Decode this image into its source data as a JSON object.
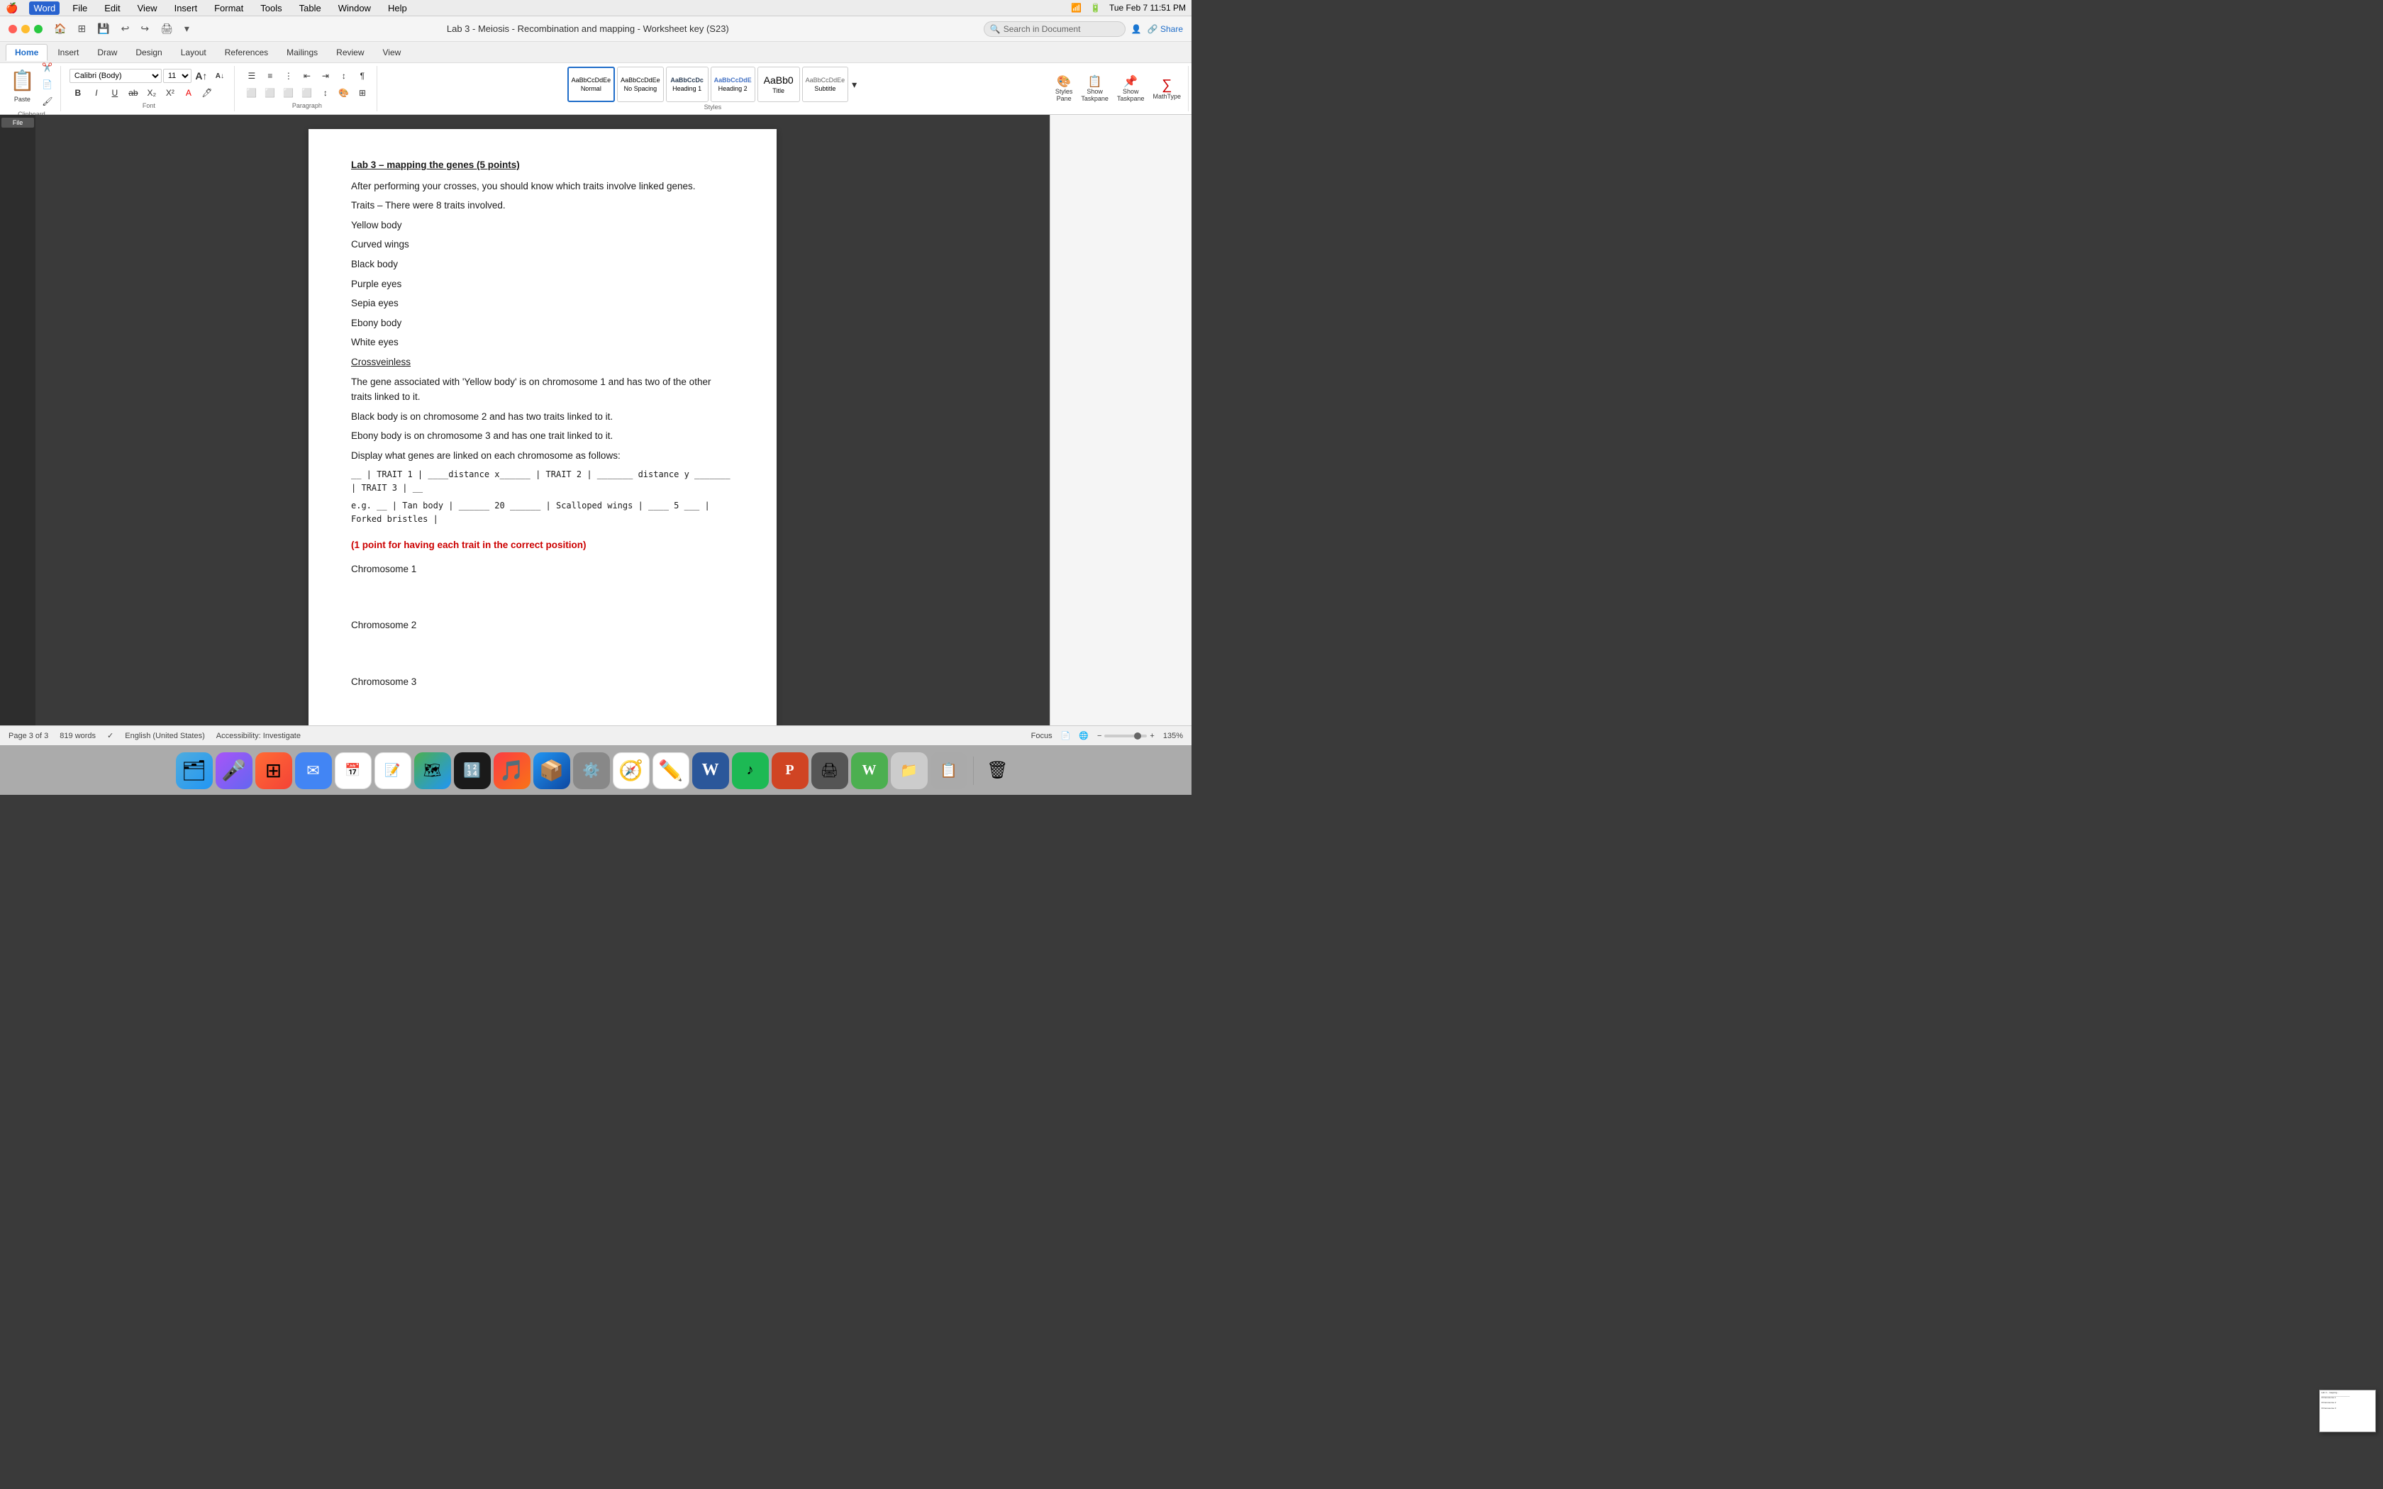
{
  "menubar": {
    "apple": "🍎",
    "app_name": "Word",
    "menus": [
      "File",
      "Edit",
      "View",
      "Insert",
      "Format",
      "Tools",
      "Table",
      "Window",
      "Help"
    ],
    "right": {
      "time": "Tue Feb 7  11:51 PM",
      "battery": "100%"
    }
  },
  "titlebar": {
    "doc_title": "Lab 3 - Meiosis - Recombination and mapping - Worksheet key (S23)",
    "search_placeholder": "Search in Document"
  },
  "ribbon": {
    "tabs": [
      "Home",
      "Insert",
      "Draw",
      "Design",
      "Layout",
      "References",
      "Mailings",
      "Review",
      "View"
    ],
    "active_tab": "Home",
    "clipboard": {
      "paste_label": "Paste",
      "cut_label": "Cut",
      "copy_label": "Copy",
      "format_painter_label": "Format Painter"
    },
    "font": {
      "name": "Calibri (Body)",
      "size": "11",
      "grow_label": "A",
      "shrink_label": "A"
    },
    "paragraph": {
      "bullets_label": "Bullets",
      "numbering_label": "Numbering"
    },
    "styles": [
      {
        "name": "Normal",
        "preview": "AaBbCcDdEe"
      },
      {
        "name": "No Spacing",
        "preview": "AaBbCcDdEe"
      },
      {
        "name": "Heading 1",
        "preview": "AaBbCcDc"
      },
      {
        "name": "Heading 2",
        "preview": "AaBbCcDdE"
      },
      {
        "name": "Title",
        "preview": "AaBb0"
      },
      {
        "name": "Subtitle",
        "preview": "AaBbCcDdEe"
      }
    ],
    "styles_pane": "Styles\nPane",
    "show_taskpane1": "Show\nTaskpane",
    "show_taskpane2": "Show\nTaskpane",
    "mathtype": "MathType"
  },
  "document": {
    "title": "Lab 3 – mapping the genes (5 points)",
    "paragraphs": [
      "After performing your crosses, you should know which traits involve linked genes.",
      "Traits – There were 8 traits involved.",
      "Yellow body",
      "Curved wings",
      "Black body",
      "Purple eyes",
      "Sepia eyes",
      "Ebony body",
      "White eyes",
      "Crossveinless",
      "The gene associated with 'Yellow body' is on chromosome 1 and has two of the other traits linked to it.",
      "Black body is on chromosome 2 and has two traits linked to it.",
      "Ebony body is on chromosome 3 and has one trait linked to it.",
      "Display what genes are linked on each chromosome as follows:"
    ],
    "trait_line": "__ | TRAIT 1 | ____distance x______ | TRAIT 2 | _______ distance y _______ | TRAIT 3 | __",
    "example_line": "e.g. __ | Tan body | ______ 20 ______ | Scalloped wings | ____ 5 ___ | Forked bristles |",
    "red_note": "(1 point for having each trait in the correct position)",
    "chromosomes": [
      "Chromosome 1",
      "Chromosome 2",
      "Chromosome 3"
    ]
  },
  "statusbar": {
    "page_info": "Page 3 of 3",
    "word_count": "819 words",
    "language": "English (United States)",
    "accessibility": "Accessibility: Investigate",
    "focus": "Focus",
    "zoom": "135%"
  },
  "dock": {
    "icons": [
      {
        "name": "finder-icon",
        "emoji": "🗂️",
        "color": "#2196F3"
      },
      {
        "name": "siri-icon",
        "emoji": "🎤",
        "color": "#9b59b6"
      },
      {
        "name": "launchpad-icon",
        "emoji": "🚀",
        "color": "#FF6B35"
      },
      {
        "name": "mail-icon",
        "emoji": "✉️",
        "color": "#4285F4"
      },
      {
        "name": "calendar-icon",
        "emoji": "📅",
        "color": "#EA4335"
      },
      {
        "name": "reminders-icon",
        "emoji": "📝",
        "color": "#FF9500"
      },
      {
        "name": "maps-icon",
        "emoji": "🗺️",
        "color": "#4CAF50"
      },
      {
        "name": "calculator-icon",
        "emoji": "🔢",
        "color": "#888"
      },
      {
        "name": "music-icon",
        "emoji": "🎵",
        "color": "#fc3c44"
      },
      {
        "name": "appstore-icon",
        "emoji": "📦",
        "color": "#2196F3"
      },
      {
        "name": "settings-icon",
        "emoji": "⚙️",
        "color": "#888"
      },
      {
        "name": "safari-icon",
        "emoji": "🧭",
        "color": "#2196F3"
      },
      {
        "name": "freeform-icon",
        "emoji": "✏️",
        "color": "#FF9500"
      },
      {
        "name": "word-icon",
        "emoji": "W",
        "color": "#2b579a"
      },
      {
        "name": "spotify-icon",
        "emoji": "🎵",
        "color": "#1DB954"
      },
      {
        "name": "powerpoint-icon",
        "emoji": "P",
        "color": "#d04423"
      },
      {
        "name": "printer-icon",
        "emoji": "🖨️",
        "color": "#555"
      },
      {
        "name": "wordperfect-icon",
        "emoji": "W",
        "color": "#4CAF50"
      },
      {
        "name": "files-icon",
        "emoji": "📁",
        "color": "#ccc"
      },
      {
        "name": "collapse-icon",
        "emoji": "📋",
        "color": "#999"
      },
      {
        "name": "trash-icon",
        "emoji": "🗑️",
        "color": "#aaa"
      }
    ]
  }
}
